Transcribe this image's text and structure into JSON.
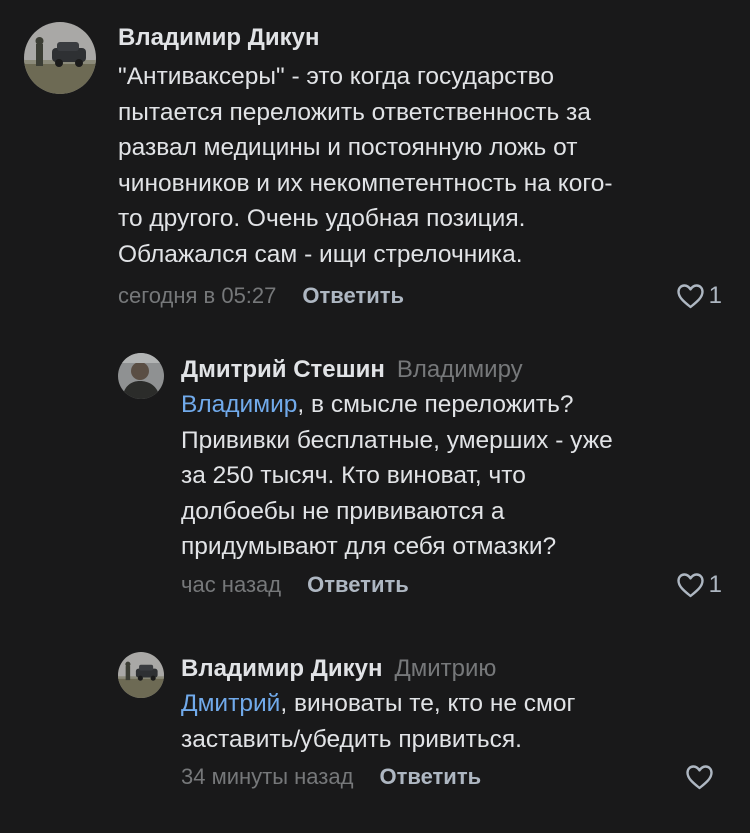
{
  "comments": [
    {
      "author": "Владимир Дикун",
      "reply_to": "",
      "mention": "",
      "text": "\"Антиваксеры\" -  это когда государство\nпытается переложить ответственность за\nразвал медицины и постоянную ложь от\nчиновников и их некомпетентность на кого-\nто другого. Очень удобная позиция.\nОблажался сам - ищи стрелочника.",
      "time": "сегодня в 05:27",
      "reply_label": "Ответить",
      "likes": "1",
      "avatar_icon": "avatar-photo-field-car"
    },
    {
      "author": "Дмитрий Стешин",
      "reply_to": "Владимиру",
      "mention": "Владимир",
      "text": ", в смысле переложить?\nПрививки бесплатные, умерших - уже\nза 250 тысяч. Кто виноват, что\nдолбоебы не прививаются а\nпридумывают для себя отмазки?",
      "time": "час назад",
      "reply_label": "Ответить",
      "likes": "1",
      "avatar_icon": "avatar-photo-portrait"
    },
    {
      "author": "Владимир Дикун",
      "reply_to": "Дмитрию",
      "mention": "Дмитрий",
      "text": ", виноваты те, кто не смог\nзаставить/убедить привиться.",
      "time": "34 минуты назад",
      "reply_label": "Ответить",
      "likes": "",
      "avatar_icon": "avatar-photo-field-car"
    }
  ],
  "colors": {
    "background": "#19191a",
    "text": "#e1e3e6",
    "secondary": "#76787a",
    "link": "#71aaeb",
    "action": "#aeb7c2"
  }
}
